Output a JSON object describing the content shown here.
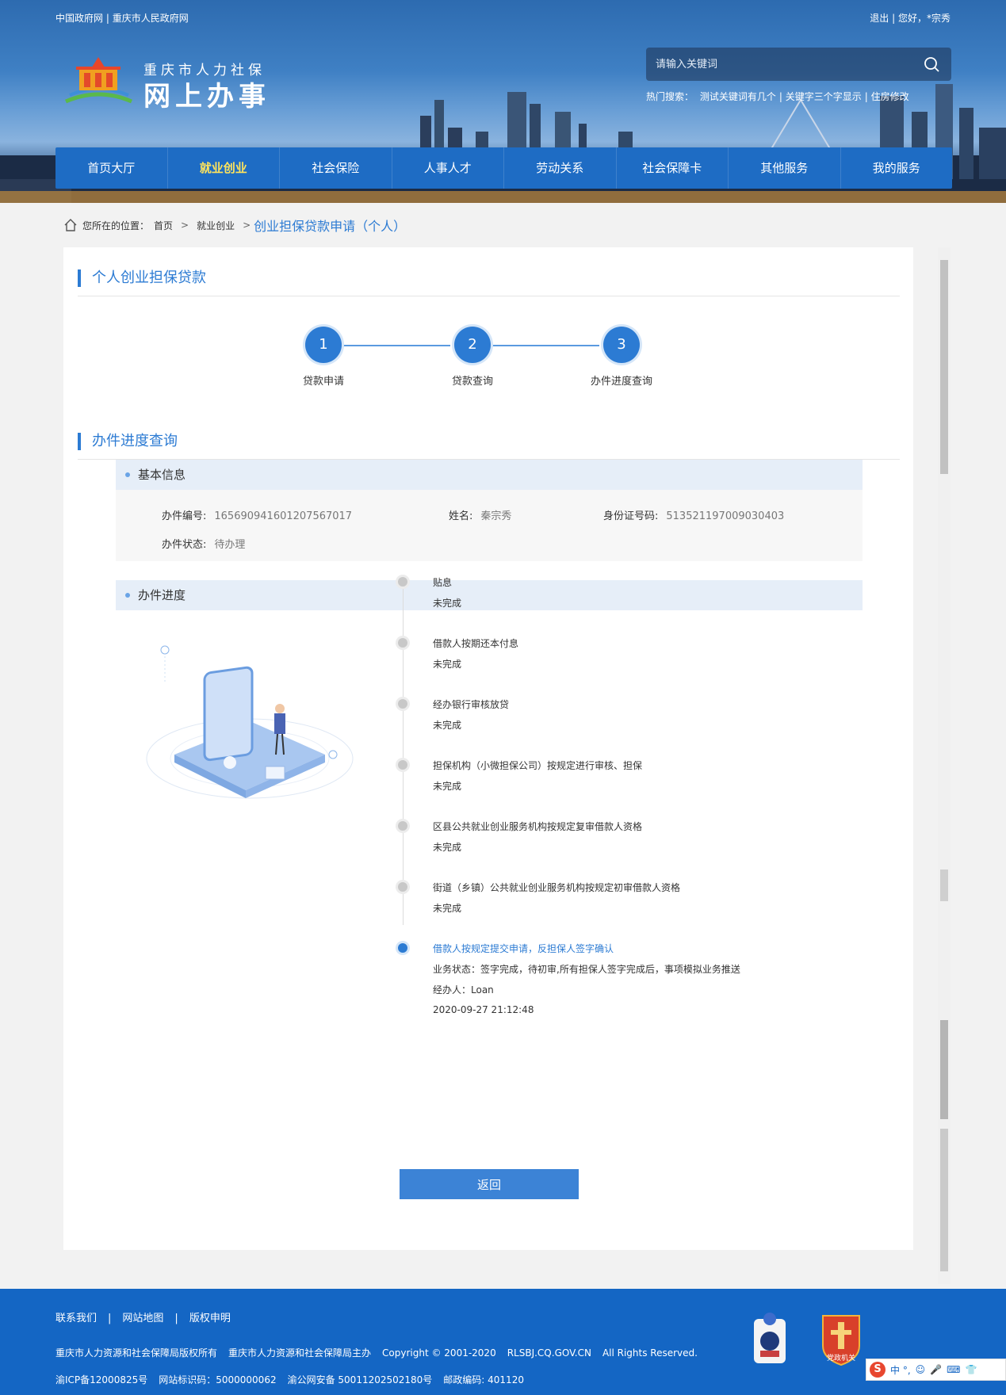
{
  "topbar": {
    "gov_link": "中国政府网",
    "city_link": "重庆市人民政府网",
    "logout": "退出",
    "greeting": "您好，*宗秀"
  },
  "logo": {
    "line1": "重庆市人力社保",
    "line2": "网上办事"
  },
  "search": {
    "placeholder": "请输入关键词",
    "hot_label": "热门搜索：",
    "hot_items": [
      "测试关键词有几个",
      "关键字三个字显示",
      "住房修改"
    ]
  },
  "nav": {
    "items": [
      {
        "label": "首页大厅",
        "active": false
      },
      {
        "label": "就业创业",
        "active": true
      },
      {
        "label": "社会保险",
        "active": false
      },
      {
        "label": "人事人才",
        "active": false
      },
      {
        "label": "劳动关系",
        "active": false
      },
      {
        "label": "社会保障卡",
        "active": false
      },
      {
        "label": "其他服务",
        "active": false
      },
      {
        "label": "我的服务",
        "active": false
      }
    ]
  },
  "breadcrumb": {
    "prefix": "您所在的位置：",
    "home": "首页",
    "level1": "就业创业",
    "current": "创业担保贷款申请（个人）"
  },
  "section1": {
    "title": "个人创业担保贷款"
  },
  "steps": [
    {
      "num": "1",
      "label": "贷款申请"
    },
    {
      "num": "2",
      "label": "贷款查询"
    },
    {
      "num": "3",
      "label": "办件进度查询"
    }
  ],
  "section2": {
    "title": "办件进度查询"
  },
  "basic": {
    "title": "基本信息",
    "case_no_label": "办件编号:",
    "case_no": "16569094160120756701​7",
    "name_label": "姓名:",
    "name": "秦宗秀",
    "id_label": "身份证号码:",
    "id": "513521197009030403",
    "status_label": "办件状态:",
    "status": "待办理"
  },
  "progress": {
    "title": "办件进度",
    "items": [
      {
        "title": "贴息",
        "status": "未完成"
      },
      {
        "title": "借款人按期还本付息",
        "status": "未完成"
      },
      {
        "title": "经办银行审核放贷",
        "status": "未完成"
      },
      {
        "title": "担保机构（小微担保公司）按规定进行审核、担保",
        "status": "未完成"
      },
      {
        "title": "区县公共就业创业服务机构按规定复审借款人资格",
        "status": "未完成"
      },
      {
        "title": "街道（乡镇）公共就业创业服务机构按规定初审借款人资格",
        "status": "未完成"
      },
      {
        "title": "借款人按规定提交申请，反担保人签字确认",
        "status": "业务状态：签字完成，待初审,所有担保人签字完成后，事项模拟业务推送",
        "handler": "经办人：Loan",
        "time": "2020-09-27 21:12:48"
      }
    ]
  },
  "back_button": "返回",
  "footer": {
    "links": [
      "联系我们",
      "网站地图",
      "版权申明"
    ],
    "copy": [
      "重庆市人力资源和社会保障局版权所有",
      "重庆市人力资源和社会保障局主办",
      "Copyright © 2001-2020",
      "RLSBJ.CQ.GOV.CN",
      "All Rights Reserved."
    ],
    "icp": [
      "渝ICP备12000825号",
      "网站标识码：5000000062",
      "渝公网安备 50011202502180号",
      "邮政编码: 401120"
    ],
    "badge2_text": "党政机关",
    "ime_text": "中 °,"
  },
  "colors": {
    "brand": "#2c7bd3",
    "nav": "#1e6cc4",
    "footer": "#1466c4",
    "active_nav": "#ffe45c"
  }
}
